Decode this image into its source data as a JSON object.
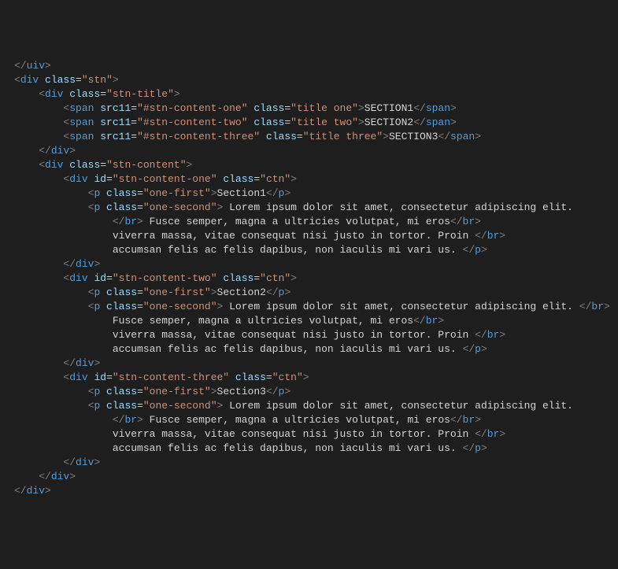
{
  "lines": [
    {
      "indent": 0,
      "tokens": [
        {
          "t": "tag",
          "v": "</"
        },
        {
          "t": "elem",
          "v": "uiv"
        },
        {
          "t": "tag",
          "v": ">"
        }
      ]
    },
    {
      "indent": 0,
      "tokens": [
        {
          "t": "tag",
          "v": "<"
        },
        {
          "t": "elem",
          "v": "div "
        },
        {
          "t": "attr",
          "v": "class"
        },
        {
          "t": "eq",
          "v": "="
        },
        {
          "t": "str",
          "v": "\"stn\""
        },
        {
          "t": "tag",
          "v": ">"
        }
      ]
    },
    {
      "indent": 1,
      "tokens": [
        {
          "t": "tag",
          "v": "<"
        },
        {
          "t": "elem",
          "v": "div "
        },
        {
          "t": "attr",
          "v": "class"
        },
        {
          "t": "eq",
          "v": "="
        },
        {
          "t": "str",
          "v": "\"stn-title\""
        },
        {
          "t": "tag",
          "v": ">"
        }
      ]
    },
    {
      "indent": 2,
      "tokens": [
        {
          "t": "tag",
          "v": "<"
        },
        {
          "t": "elem",
          "v": "span "
        },
        {
          "t": "attr",
          "v": "src11"
        },
        {
          "t": "eq",
          "v": "="
        },
        {
          "t": "str",
          "v": "\"#stn-content-one\" "
        },
        {
          "t": "attr",
          "v": "class"
        },
        {
          "t": "eq",
          "v": "="
        },
        {
          "t": "str",
          "v": "\"title one\""
        },
        {
          "t": "tag",
          "v": ">"
        },
        {
          "t": "txt",
          "v": "SECTION1"
        },
        {
          "t": "tag",
          "v": "</"
        },
        {
          "t": "elem",
          "v": "span"
        },
        {
          "t": "tag",
          "v": ">"
        }
      ]
    },
    {
      "indent": 2,
      "tokens": [
        {
          "t": "tag",
          "v": "<"
        },
        {
          "t": "elem",
          "v": "span "
        },
        {
          "t": "attr",
          "v": "src11"
        },
        {
          "t": "eq",
          "v": "="
        },
        {
          "t": "str",
          "v": "\"#stn-content-two\" "
        },
        {
          "t": "attr",
          "v": "class"
        },
        {
          "t": "eq",
          "v": "="
        },
        {
          "t": "str",
          "v": "\"title two\""
        },
        {
          "t": "tag",
          "v": ">"
        },
        {
          "t": "txt",
          "v": "SECTION2"
        },
        {
          "t": "tag",
          "v": "</"
        },
        {
          "t": "elem",
          "v": "span"
        },
        {
          "t": "tag",
          "v": ">"
        }
      ]
    },
    {
      "indent": 2,
      "tokens": [
        {
          "t": "tag",
          "v": "<"
        },
        {
          "t": "elem",
          "v": "span "
        },
        {
          "t": "attr",
          "v": "src11"
        },
        {
          "t": "eq",
          "v": "="
        },
        {
          "t": "str",
          "v": "\"#stn-content-three\" "
        },
        {
          "t": "attr",
          "v": "class"
        },
        {
          "t": "eq",
          "v": "="
        },
        {
          "t": "str",
          "v": "\"title three\""
        },
        {
          "t": "tag",
          "v": ">"
        },
        {
          "t": "txt",
          "v": "SECTION3"
        },
        {
          "t": "tag",
          "v": "</"
        },
        {
          "t": "elem",
          "v": "span"
        },
        {
          "t": "tag",
          "v": ">"
        }
      ]
    },
    {
      "indent": 1,
      "tokens": [
        {
          "t": "tag",
          "v": "</"
        },
        {
          "t": "elem",
          "v": "div"
        },
        {
          "t": "tag",
          "v": ">"
        }
      ]
    },
    {
      "indent": 1,
      "tokens": [
        {
          "t": "tag",
          "v": "<"
        },
        {
          "t": "elem",
          "v": "div "
        },
        {
          "t": "attr",
          "v": "class"
        },
        {
          "t": "eq",
          "v": "="
        },
        {
          "t": "str",
          "v": "\"stn-content\""
        },
        {
          "t": "tag",
          "v": ">"
        }
      ]
    },
    {
      "indent": 2,
      "tokens": [
        {
          "t": "tag",
          "v": "<"
        },
        {
          "t": "elem",
          "v": "div "
        },
        {
          "t": "attr",
          "v": "id"
        },
        {
          "t": "eq",
          "v": "="
        },
        {
          "t": "str",
          "v": "\"stn-content-one\" "
        },
        {
          "t": "attr",
          "v": "class"
        },
        {
          "t": "eq",
          "v": "="
        },
        {
          "t": "str",
          "v": "\"ctn\""
        },
        {
          "t": "tag",
          "v": ">"
        }
      ]
    },
    {
      "indent": 3,
      "tokens": [
        {
          "t": "tag",
          "v": "<"
        },
        {
          "t": "elem",
          "v": "p "
        },
        {
          "t": "attr",
          "v": "class"
        },
        {
          "t": "eq",
          "v": "="
        },
        {
          "t": "str",
          "v": "\"one-first\""
        },
        {
          "t": "tag",
          "v": ">"
        },
        {
          "t": "txt",
          "v": "Section1"
        },
        {
          "t": "tag",
          "v": "</"
        },
        {
          "t": "elem",
          "v": "p"
        },
        {
          "t": "tag",
          "v": ">"
        }
      ]
    },
    {
      "indent": 3,
      "tokens": [
        {
          "t": "tag",
          "v": "<"
        },
        {
          "t": "elem",
          "v": "p "
        },
        {
          "t": "attr",
          "v": "class"
        },
        {
          "t": "eq",
          "v": "="
        },
        {
          "t": "str",
          "v": "\"one-second\""
        },
        {
          "t": "tag",
          "v": ">"
        },
        {
          "t": "txt",
          "v": " Lorem ipsum dolor sit amet, consectetur adipiscing elit."
        }
      ]
    },
    {
      "indent": 4,
      "tokens": [
        {
          "t": "tag",
          "v": "</"
        },
        {
          "t": "elem",
          "v": "br"
        },
        {
          "t": "tag",
          "v": ">"
        },
        {
          "t": "txt",
          "v": " Fusce semper, magna a ultricies volutpat, mi eros"
        },
        {
          "t": "tag",
          "v": "</"
        },
        {
          "t": "elem",
          "v": "br"
        },
        {
          "t": "tag",
          "v": ">"
        }
      ]
    },
    {
      "indent": 4,
      "tokens": [
        {
          "t": "txt",
          "v": "viverra massa, vitae consequat nisi justo in tortor. Proin "
        },
        {
          "t": "tag",
          "v": "</"
        },
        {
          "t": "elem",
          "v": "br"
        },
        {
          "t": "tag",
          "v": ">"
        }
      ]
    },
    {
      "indent": 4,
      "tokens": [
        {
          "t": "txt",
          "v": "accumsan felis ac felis dapibus, non iaculis mi vari us. "
        },
        {
          "t": "tag",
          "v": "</"
        },
        {
          "t": "elem",
          "v": "p"
        },
        {
          "t": "tag",
          "v": ">"
        }
      ]
    },
    {
      "indent": 2,
      "tokens": [
        {
          "t": "tag",
          "v": "</"
        },
        {
          "t": "elem",
          "v": "div"
        },
        {
          "t": "tag",
          "v": ">"
        }
      ]
    },
    {
      "indent": 2,
      "tokens": [
        {
          "t": "tag",
          "v": "<"
        },
        {
          "t": "elem",
          "v": "div "
        },
        {
          "t": "attr",
          "v": "id"
        },
        {
          "t": "eq",
          "v": "="
        },
        {
          "t": "str",
          "v": "\"stn-content-two\" "
        },
        {
          "t": "attr",
          "v": "class"
        },
        {
          "t": "eq",
          "v": "="
        },
        {
          "t": "str",
          "v": "\"ctn\""
        },
        {
          "t": "tag",
          "v": ">"
        }
      ]
    },
    {
      "indent": 3,
      "tokens": [
        {
          "t": "tag",
          "v": "<"
        },
        {
          "t": "elem",
          "v": "p "
        },
        {
          "t": "attr",
          "v": "class"
        },
        {
          "t": "eq",
          "v": "="
        },
        {
          "t": "str",
          "v": "\"one-first\""
        },
        {
          "t": "tag",
          "v": ">"
        },
        {
          "t": "txt",
          "v": "Section2"
        },
        {
          "t": "tag",
          "v": "</"
        },
        {
          "t": "elem",
          "v": "p"
        },
        {
          "t": "tag",
          "v": ">"
        }
      ]
    },
    {
      "indent": 3,
      "tokens": [
        {
          "t": "tag",
          "v": "<"
        },
        {
          "t": "elem",
          "v": "p "
        },
        {
          "t": "attr",
          "v": "class"
        },
        {
          "t": "eq",
          "v": "="
        },
        {
          "t": "str",
          "v": "\"one-second\""
        },
        {
          "t": "tag",
          "v": ">"
        },
        {
          "t": "txt",
          "v": " Lorem ipsum dolor sit amet, consectetur adipiscing elit. "
        },
        {
          "t": "tag",
          "v": "</"
        },
        {
          "t": "elem",
          "v": "br"
        },
        {
          "t": "tag",
          "v": ">"
        }
      ]
    },
    {
      "indent": 4,
      "tokens": [
        {
          "t": "txt",
          "v": "Fusce semper, magna a ultricies volutpat, mi eros"
        },
        {
          "t": "tag",
          "v": "</"
        },
        {
          "t": "elem",
          "v": "br"
        },
        {
          "t": "tag",
          "v": ">"
        }
      ]
    },
    {
      "indent": 4,
      "tokens": [
        {
          "t": "txt",
          "v": "viverra massa, vitae consequat nisi justo in tortor. Proin "
        },
        {
          "t": "tag",
          "v": "</"
        },
        {
          "t": "elem",
          "v": "br"
        },
        {
          "t": "tag",
          "v": ">"
        }
      ]
    },
    {
      "indent": 4,
      "tokens": [
        {
          "t": "txt",
          "v": "accumsan felis ac felis dapibus, non iaculis mi vari us. "
        },
        {
          "t": "tag",
          "v": "</"
        },
        {
          "t": "elem",
          "v": "p"
        },
        {
          "t": "tag",
          "v": ">"
        }
      ]
    },
    {
      "indent": 2,
      "tokens": [
        {
          "t": "tag",
          "v": "</"
        },
        {
          "t": "elem",
          "v": "div"
        },
        {
          "t": "tag",
          "v": ">"
        }
      ]
    },
    {
      "indent": 2,
      "tokens": [
        {
          "t": "tag",
          "v": "<"
        },
        {
          "t": "elem",
          "v": "div "
        },
        {
          "t": "attr",
          "v": "id"
        },
        {
          "t": "eq",
          "v": "="
        },
        {
          "t": "str",
          "v": "\"stn-content-three\" "
        },
        {
          "t": "attr",
          "v": "class"
        },
        {
          "t": "eq",
          "v": "="
        },
        {
          "t": "str",
          "v": "\"ctn\""
        },
        {
          "t": "tag",
          "v": ">"
        }
      ]
    },
    {
      "indent": 3,
      "tokens": [
        {
          "t": "tag",
          "v": "<"
        },
        {
          "t": "elem",
          "v": "p "
        },
        {
          "t": "attr",
          "v": "class"
        },
        {
          "t": "eq",
          "v": "="
        },
        {
          "t": "str",
          "v": "\"one-first\""
        },
        {
          "t": "tag",
          "v": ">"
        },
        {
          "t": "txt",
          "v": "Section3"
        },
        {
          "t": "tag",
          "v": "</"
        },
        {
          "t": "elem",
          "v": "p"
        },
        {
          "t": "tag",
          "v": ">"
        }
      ]
    },
    {
      "indent": 3,
      "tokens": [
        {
          "t": "tag",
          "v": "<"
        },
        {
          "t": "elem",
          "v": "p "
        },
        {
          "t": "attr",
          "v": "class"
        },
        {
          "t": "eq",
          "v": "="
        },
        {
          "t": "str",
          "v": "\"one-second\""
        },
        {
          "t": "tag",
          "v": ">"
        },
        {
          "t": "txt",
          "v": " Lorem ipsum dolor sit amet, consectetur adipiscing elit."
        }
      ]
    },
    {
      "indent": 4,
      "tokens": [
        {
          "t": "tag",
          "v": "</"
        },
        {
          "t": "elem",
          "v": "br"
        },
        {
          "t": "tag",
          "v": ">"
        },
        {
          "t": "txt",
          "v": " Fusce semper, magna a ultricies volutpat, mi eros"
        },
        {
          "t": "tag",
          "v": "</"
        },
        {
          "t": "elem",
          "v": "br"
        },
        {
          "t": "tag",
          "v": ">"
        }
      ]
    },
    {
      "indent": 4,
      "tokens": [
        {
          "t": "txt",
          "v": "viverra massa, vitae consequat nisi justo in tortor. Proin "
        },
        {
          "t": "tag",
          "v": "</"
        },
        {
          "t": "elem",
          "v": "br"
        },
        {
          "t": "tag",
          "v": ">"
        }
      ]
    },
    {
      "indent": 4,
      "tokens": [
        {
          "t": "txt",
          "v": "accumsan felis ac felis dapibus, non iaculis mi vari us. "
        },
        {
          "t": "tag",
          "v": "</"
        },
        {
          "t": "elem",
          "v": "p"
        },
        {
          "t": "tag",
          "v": ">"
        }
      ]
    },
    {
      "indent": 2,
      "tokens": [
        {
          "t": "tag",
          "v": "</"
        },
        {
          "t": "elem",
          "v": "div"
        },
        {
          "t": "tag",
          "v": ">"
        }
      ]
    },
    {
      "indent": 1,
      "tokens": [
        {
          "t": "tag",
          "v": "</"
        },
        {
          "t": "elem",
          "v": "div"
        },
        {
          "t": "tag",
          "v": ">"
        }
      ]
    },
    {
      "indent": 0,
      "tokens": [
        {
          "t": "tag",
          "v": "</"
        },
        {
          "t": "elem",
          "v": "div"
        },
        {
          "t": "tag",
          "v": ">"
        }
      ]
    }
  ],
  "indent_unit": "    "
}
